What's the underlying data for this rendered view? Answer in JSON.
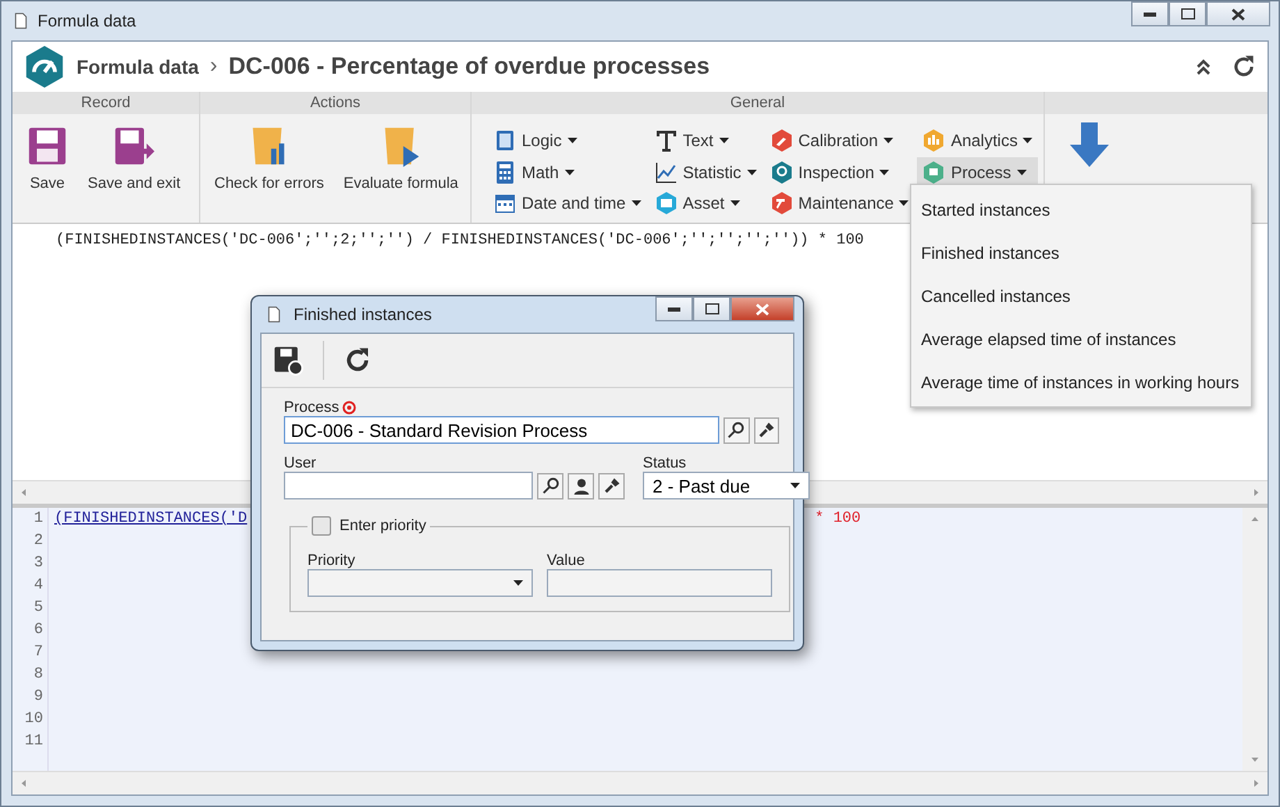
{
  "window": {
    "title": "Formula data"
  },
  "header": {
    "breadcrumb": "Formula data",
    "separator": "›",
    "title": "DC-006 - Percentage of overdue processes"
  },
  "ribbon": {
    "groups": [
      {
        "title": "Record",
        "buttons": [
          "Save",
          "Save and exit"
        ]
      },
      {
        "title": "Actions",
        "buttons": [
          "Check for errors",
          "Evaluate formula"
        ]
      },
      {
        "title": "General",
        "items": [
          {
            "label": "Logic",
            "selected": false
          },
          {
            "label": "Text",
            "selected": false
          },
          {
            "label": "Calibration",
            "selected": false
          },
          {
            "label": "Analytics",
            "selected": false
          },
          {
            "label": "Math",
            "selected": false
          },
          {
            "label": "Statistic",
            "selected": false
          },
          {
            "label": "Inspection",
            "selected": false
          },
          {
            "label": "Process",
            "selected": true
          },
          {
            "label": "Date and time",
            "selected": false
          },
          {
            "label": "Asset",
            "selected": false
          },
          {
            "label": "Maintenance",
            "selected": false
          }
        ]
      }
    ]
  },
  "formula": "(FINISHEDINSTANCES('DC-006';'';2;'';'') / FINISHEDINSTANCES('DC-006';'';'';'';'')) * 100",
  "editor": {
    "line_1_start": "(FINISHEDINSTANCES('D",
    "line_1_end": "* 100",
    "line_numbers": [
      "1",
      "2",
      "3",
      "4",
      "5",
      "6",
      "7",
      "8",
      "9",
      "10",
      "11"
    ]
  },
  "menu": [
    "Started instances",
    "Finished instances",
    "Cancelled instances",
    "Average elapsed time of instances",
    "Average time of instances in working hours"
  ],
  "dialog": {
    "title": "Finished instances",
    "process": {
      "label": "Process",
      "required": true,
      "value": "DC-006 - Standard Revision Process"
    },
    "user": {
      "label": "User"
    },
    "status": {
      "label": "Status",
      "value": "2 - Past due"
    },
    "enter_priority": {
      "label": "Enter priority",
      "checked": false
    },
    "priority": {
      "label": "Priority"
    },
    "value": {
      "label": "Value"
    }
  }
}
